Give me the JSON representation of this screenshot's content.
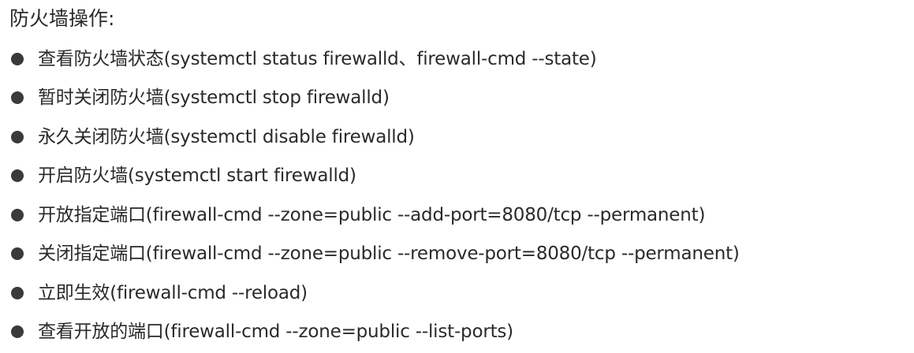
{
  "heading": "防火墙操作:",
  "items": [
    "查看防火墙状态(systemctl status firewalld、firewall-cmd --state)",
    "暂时关闭防火墙(systemctl stop firewalld)",
    "永久关闭防火墙(systemctl disable firewalld)",
    "开启防火墙(systemctl start firewalld)",
    "开放指定端口(firewall-cmd --zone=public --add-port=8080/tcp --permanent)",
    "关闭指定端口(firewall-cmd --zone=public --remove-port=8080/tcp --permanent)",
    "立即生效(firewall-cmd --reload)",
    "查看开放的端口(firewall-cmd --zone=public --list-ports)"
  ],
  "colors": {
    "text": "#2a2a2a",
    "bullet": "#3a3a3a",
    "background": "#ffffff"
  }
}
